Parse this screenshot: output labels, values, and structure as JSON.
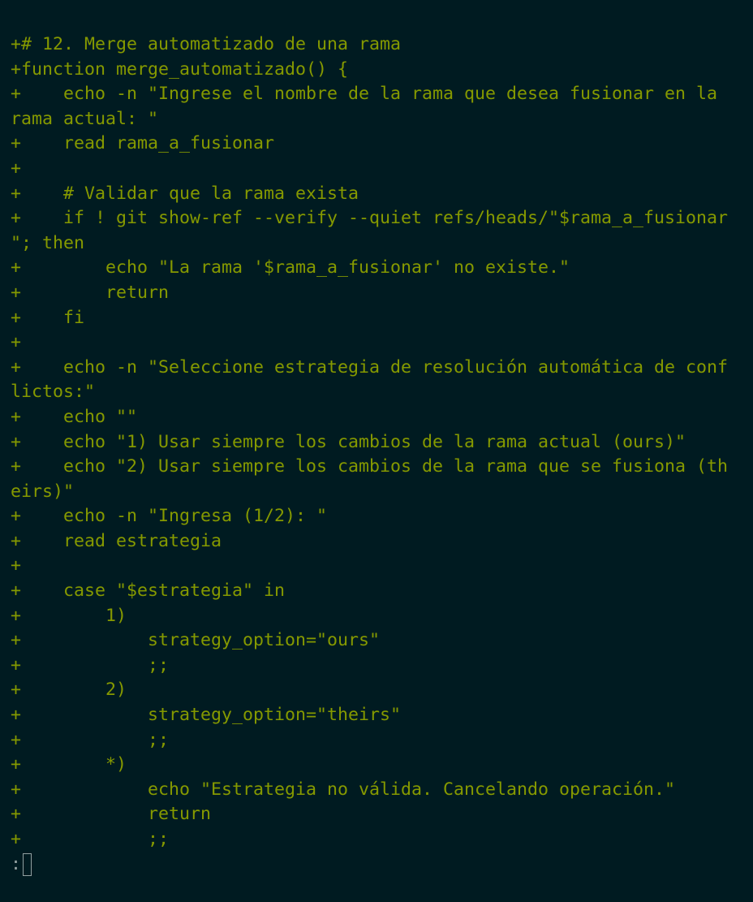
{
  "diff_lines": [
    "+# 12. Merge automatizado de una rama",
    "+function merge_automatizado() {",
    "+    echo -n \"Ingrese el nombre de la rama que desea fusionar en la",
    "rama actual: \"",
    "+    read rama_a_fusionar",
    "+",
    "+    # Validar que la rama exista",
    "+    if ! git show-ref --verify --quiet refs/heads/\"$rama_a_fusionar",
    "\"; then",
    "+        echo \"La rama '$rama_a_fusionar' no existe.\"",
    "+        return",
    "+    fi",
    "+",
    "+    echo -n \"Seleccione estrategia de resolución automática de conf",
    "lictos:\"",
    "+    echo \"\"",
    "+    echo \"1) Usar siempre los cambios de la rama actual (ours)\"",
    "+    echo \"2) Usar siempre los cambios de la rama que se fusiona (th",
    "eirs)\"",
    "+    echo -n \"Ingresa (1/2): \"",
    "+    read estrategia",
    "+",
    "+    case \"$estrategia\" in",
    "+        1)",
    "+            strategy_option=\"ours\"",
    "+            ;;",
    "+        2)",
    "+            strategy_option=\"theirs\"",
    "+            ;;",
    "+        *)",
    "+            echo \"Estrategia no válida. Cancelando operación.\"",
    "+            return",
    "+            ;;"
  ],
  "pager": {
    "prompt": ":"
  },
  "colors": {
    "background": "#001b21",
    "added_text": "#859900",
    "prompt_text": "#93a1a1"
  }
}
